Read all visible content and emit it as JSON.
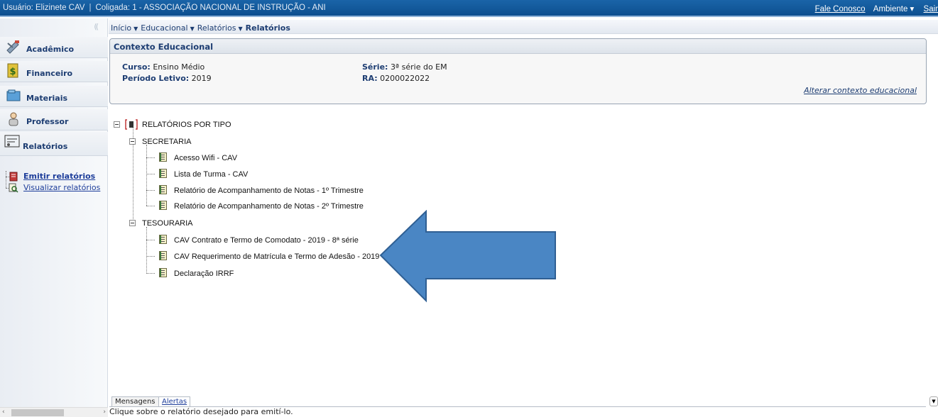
{
  "topbar": {
    "user": "Usuário: Elizinete CAV",
    "coligada": "Coligada: 1 - ASSOCIAÇÃO NACIONAL DE INSTRUÇÃO - ANI",
    "contact_link": "Fale Conosco",
    "environment": "Ambiente ▾",
    "exit_link": "Sair"
  },
  "sidebar": {
    "collapse": "((",
    "items": [
      {
        "label": "Acadêmico",
        "icon": "academic-icon"
      },
      {
        "label": "Financeiro",
        "icon": "money-icon"
      },
      {
        "label": "Materiais",
        "icon": "folder-icon"
      },
      {
        "label": "Professor",
        "icon": "teacher-icon"
      },
      {
        "label": "Relatórios",
        "icon": "reports-icon"
      }
    ],
    "subitems": [
      {
        "label": "Emitir relatórios",
        "icon": "print-report-icon"
      },
      {
        "label": "Visualizar relatórios",
        "icon": "view-report-icon"
      }
    ]
  },
  "breadcrumb": {
    "items": [
      "Início",
      "Educacional",
      "Relatórios"
    ],
    "current": "Relatórios"
  },
  "context": {
    "title": "Contexto Educacional",
    "curso_label": "Curso:",
    "curso_value": "Ensino Médio",
    "periodo_label": "Período Letivo:",
    "periodo_value": "2019",
    "serie_label": "Série:",
    "serie_value": "3ª série do EM",
    "ra_label": "RA:",
    "ra_value": "0200022022",
    "change_link": "Alterar contexto educacional"
  },
  "tree": {
    "root": "RELATÓRIOS POR TIPO",
    "groups": [
      {
        "name": "SECRETARIA",
        "items": [
          "Acesso Wifi - CAV",
          "Lista de Turma - CAV",
          "Relatório de Acompanhamento de Notas - 1º Trimestre",
          "Relatório de Acompanhamento de Notas - 2º Trimestre"
        ]
      },
      {
        "name": "TESOURARIA",
        "items": [
          "CAV Contrato e Termo de Comodato - 2019 - 8ª série",
          "CAV Requerimento de Matrícula e Termo de Adesão - 2019",
          "Declaração IRRF"
        ]
      }
    ]
  },
  "messages": {
    "tab_messages": "Mensagens",
    "tab_alerts": "Alertas",
    "text": "Clique sobre o relatório desejado para emití-lo."
  },
  "colors": {
    "topbar": "#1a64a8",
    "nav_text": "#1d3d72",
    "arrow": "#4a86c4"
  }
}
